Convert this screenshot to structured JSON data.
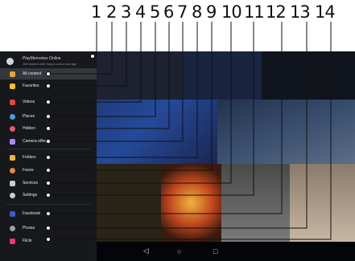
{
  "callouts": [
    "1",
    "2",
    "3",
    "4",
    "5",
    "6",
    "7",
    "8",
    "9",
    "10",
    "11",
    "12",
    "13",
    "14"
  ],
  "header": {
    "title": "PlayMemories Online",
    "subtitle": "Get started with Sony's online storage"
  },
  "menu": [
    {
      "label": "All content",
      "icon": "all-content-icon",
      "color": "#e8a53a",
      "selected": true
    },
    {
      "label": "Favorites",
      "icon": "star-icon",
      "color": "#f2c12e"
    },
    {
      "label": "Videos",
      "icon": "video-icon",
      "color": "#e0493f"
    },
    {
      "label": "Places",
      "icon": "map-pin-icon",
      "color": "#4aa0e0"
    },
    {
      "label": "Hidden",
      "icon": "eye-icon",
      "color": "#e55a6a"
    },
    {
      "label": "Camera effects",
      "icon": "camera-icon",
      "color": "#a78bf0"
    },
    {
      "label": "Folders",
      "icon": "folder-icon",
      "color": "#f0b43a"
    },
    {
      "label": "Faces",
      "icon": "face-icon",
      "color": "#e98a3a"
    },
    {
      "label": "Services",
      "icon": "services-icon",
      "color": "#c9cdd3"
    },
    {
      "label": "Settings",
      "icon": "settings-icon",
      "color": "#c9cdd3"
    },
    {
      "label": "Facebook",
      "icon": "facebook-icon",
      "color": "#3b5fbf"
    },
    {
      "label": "Picasa",
      "icon": "picasa-icon",
      "color": "#9aa1a9"
    },
    {
      "label": "Flickr",
      "icon": "flickr-icon",
      "color": "#e53d6a"
    }
  ],
  "navbar": {
    "back": "◁",
    "home": "○",
    "recent": "□"
  }
}
